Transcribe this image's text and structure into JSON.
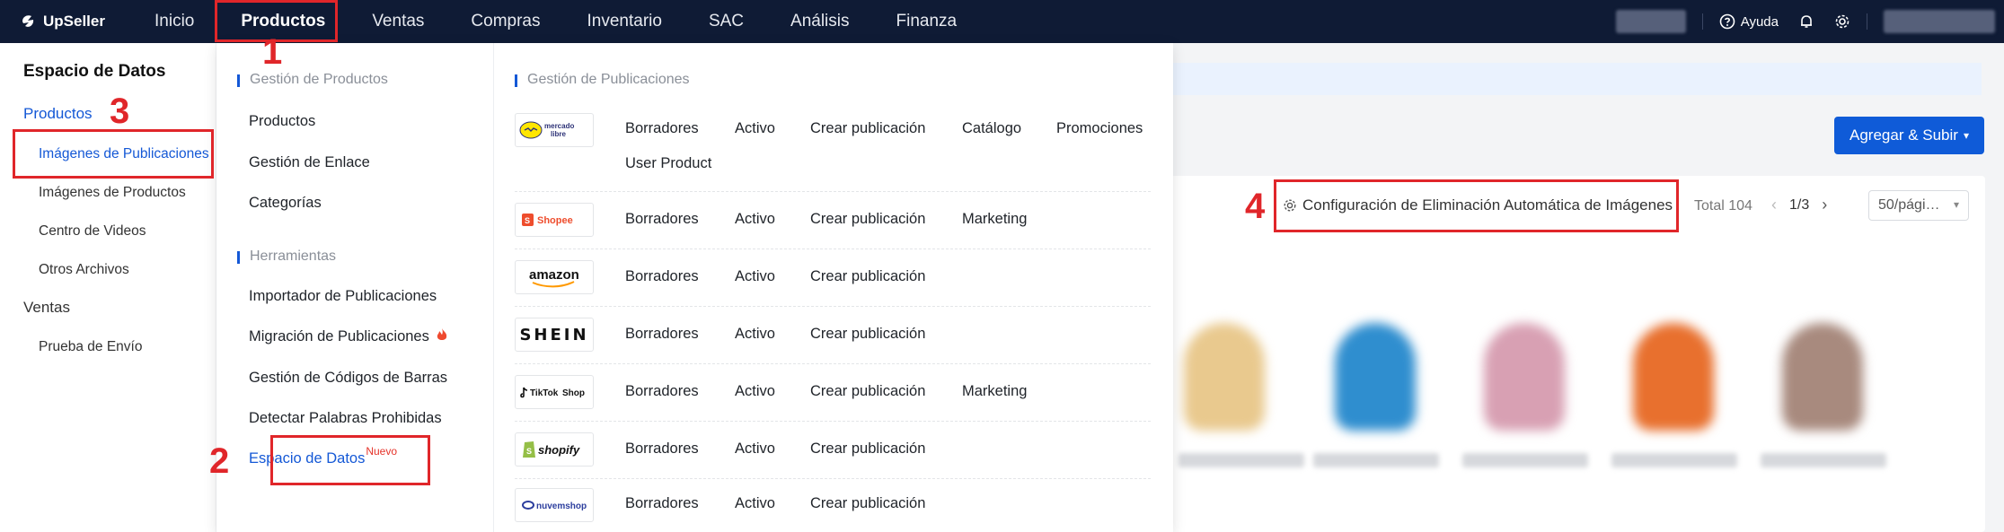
{
  "topbar": {
    "brand": "UpSeller",
    "nav": [
      {
        "label": "Inicio",
        "active": false
      },
      {
        "label": "Productos",
        "active": true
      },
      {
        "label": "Ventas",
        "active": false
      },
      {
        "label": "Compras",
        "active": false
      },
      {
        "label": "Inventario",
        "active": false
      },
      {
        "label": "SAC",
        "active": false
      },
      {
        "label": "Análisis",
        "active": false
      },
      {
        "label": "Finanza",
        "active": false
      }
    ],
    "help_label": "Ayuda"
  },
  "sidebar": {
    "title": "Espacio de Datos",
    "group_products": "Productos",
    "items": [
      {
        "label": "Imágenes de Publicaciones",
        "active": true
      },
      {
        "label": "Imágenes de Productos",
        "active": false
      },
      {
        "label": "Centro de Videos",
        "active": false
      },
      {
        "label": "Otros Archivos",
        "active": false
      }
    ],
    "group_sales": "Ventas",
    "sales_items": [
      {
        "label": "Prueba de Envío"
      }
    ]
  },
  "dropdown": {
    "product_mgmt": {
      "heading": "Gestión de Productos",
      "items": [
        "Productos",
        "Gestión de Enlace",
        "Categorías"
      ]
    },
    "tools": {
      "heading": "Herramientas",
      "items": [
        "Importador de Publicaciones",
        "Migración de Publicaciones",
        "Gestión de Códigos de Barras",
        "Detectar Palabras Prohibidas",
        "Espacio de Datos"
      ],
      "new_badge": "Nuevo"
    },
    "listings": {
      "heading": "Gestión de Publicaciones",
      "platforms": [
        {
          "name": "mercado libre",
          "icon": "mercadolibre-logo",
          "links": [
            "Borradores",
            "Activo",
            "Crear publicación",
            "Catálogo",
            "Promociones",
            "User Product"
          ]
        },
        {
          "name": "Shopee",
          "icon": "shopee-logo",
          "links": [
            "Borradores",
            "Activo",
            "Crear publicación",
            "Marketing"
          ]
        },
        {
          "name": "amazon",
          "icon": "amazon-logo",
          "links": [
            "Borradores",
            "Activo",
            "Crear publicación"
          ]
        },
        {
          "name": "SHEIN",
          "icon": "shein-logo",
          "links": [
            "Borradores",
            "Activo",
            "Crear publicación"
          ]
        },
        {
          "name": "TikTok Shop",
          "icon": "tiktok-shop-logo",
          "links": [
            "Borradores",
            "Activo",
            "Crear publicación",
            "Marketing"
          ]
        },
        {
          "name": "shopify",
          "icon": "shopify-logo",
          "links": [
            "Borradores",
            "Activo",
            "Crear publicación"
          ]
        },
        {
          "name": "nuvemshop",
          "icon": "nuvemshop-logo",
          "links": [
            "Borradores",
            "Activo",
            "Crear publicación"
          ]
        }
      ]
    }
  },
  "main": {
    "add_upload_button": "Agregar & Subir",
    "auto_delete_link": "Configuración de Eliminación Automática de Imágenes",
    "total": "Total 104",
    "page_indicator": "1/3",
    "page_size": "50/pági…"
  },
  "annotations": [
    "1",
    "2",
    "3",
    "4"
  ],
  "colors": {
    "nav_bg": "#0f1b35",
    "accent": "#1458d6",
    "annotation": "#e0262a"
  }
}
